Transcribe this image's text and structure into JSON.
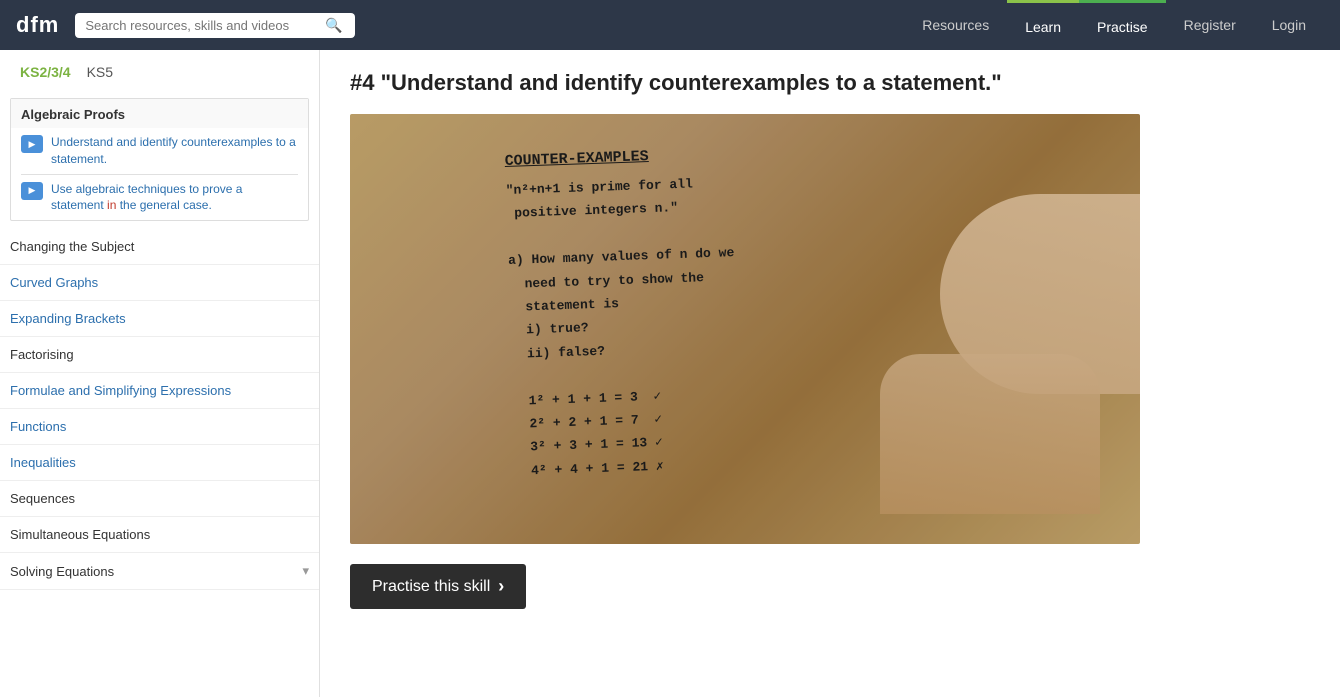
{
  "navbar": {
    "logo": "dfm",
    "search_placeholder": "Search resources, skills and videos",
    "links": [
      {
        "label": "Resources",
        "key": "resources"
      },
      {
        "label": "Learn",
        "key": "learn"
      },
      {
        "label": "Practise",
        "key": "practise"
      },
      {
        "label": "Register",
        "key": "register"
      },
      {
        "label": "Login",
        "key": "login"
      }
    ]
  },
  "breadcrumb": {
    "ks234": "KS2/3/4",
    "ks5": "KS5"
  },
  "sidebar": {
    "topic_section": {
      "title": "Algebraic Proofs",
      "videos": [
        {
          "key": "video1",
          "text_parts": [
            "Understand and identify counterexamples to a statement."
          ]
        },
        {
          "key": "video2",
          "text_parts": [
            "Use algebraic techniques to prove a statement ",
            "in",
            " the general case."
          ]
        }
      ]
    },
    "list_items": [
      {
        "key": "changing",
        "label": "Changing the Subject",
        "link": true
      },
      {
        "key": "curved",
        "label": "Curved Graphs",
        "link": true
      },
      {
        "key": "expanding",
        "label": "Expanding Brackets",
        "link": true
      },
      {
        "key": "factorising",
        "label": "Factorising",
        "link": false
      },
      {
        "key": "formulae",
        "label": "Formulae and Simplifying Expressions",
        "link": true
      },
      {
        "key": "functions",
        "label": "Functions",
        "link": true
      },
      {
        "key": "inequalities",
        "label": "Inequalities",
        "link": true
      },
      {
        "key": "sequences",
        "label": "Sequences",
        "link": false
      },
      {
        "key": "simultaneous",
        "label": "Simultaneous Equations",
        "link": false
      },
      {
        "key": "solving",
        "label": "Solving Equations",
        "link": false
      }
    ]
  },
  "content": {
    "title": "#4 \"Understand and identify counterexamples to a statement.\"",
    "photo_title": "COUNTER-EXAMPLES",
    "photo_lines": [
      "\"n²+n+1 is prime for all",
      " positive integers n.\"",
      "",
      "a) How many values of n do we",
      "   need to try to show the",
      "   statement is",
      "   i) true?",
      "   ii) false?",
      "",
      "   1² + 1 + 1 = 3  ✓",
      "   2² + 2 + 1 = 7  ✓",
      "   3² + 3 + 1 = 13  ✓",
      "   4² + 4 + 1 = 21  ✗"
    ],
    "practise_button": "Practise this skill"
  }
}
